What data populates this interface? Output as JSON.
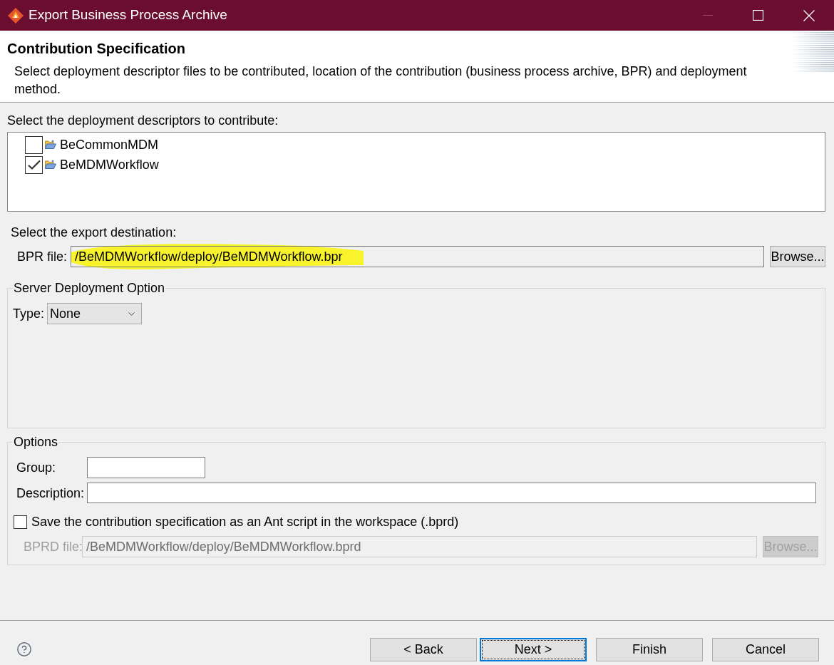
{
  "window": {
    "title": "Export Business Process Archive"
  },
  "header": {
    "title": "Contribution Specification",
    "description": "Select deployment descriptor files to be contributed, location of the contribution (business process archive, BPR) and deployment method."
  },
  "descriptors": {
    "label": "Select the deployment descriptors to contribute:",
    "items": [
      {
        "name": "BeCommonMDM",
        "checked": false
      },
      {
        "name": "BeMDMWorkflow",
        "checked": true
      }
    ]
  },
  "destination": {
    "label": "Select the export destination:",
    "field_label": "BPR file:",
    "value": "/BeMDMWorkflow/deploy/BeMDMWorkflow.bpr",
    "highlighted": true,
    "button": "Browse..."
  },
  "server_deployment": {
    "title": "Server Deployment Option",
    "type_label": "Type:",
    "type_value": "None"
  },
  "options": {
    "title": "Options",
    "group_label": "Group:",
    "description_label": "Description:",
    "save_script": {
      "label": "Save the contribution specification as an Ant script in the workspace (.bprd)",
      "checked": false
    },
    "bprd": {
      "label": "BPRD file:",
      "value": "/BeMDMWorkflow/deploy/BeMDMWorkflow.bprd",
      "disabled": true,
      "button": "Browse..."
    }
  },
  "buttons": [
    {
      "label": "< Back",
      "focused": false
    },
    {
      "label": "Next >",
      "focused": true
    },
    {
      "label": "Finish",
      "focused": false
    },
    {
      "label": "Cancel",
      "focused": false
    }
  ]
}
